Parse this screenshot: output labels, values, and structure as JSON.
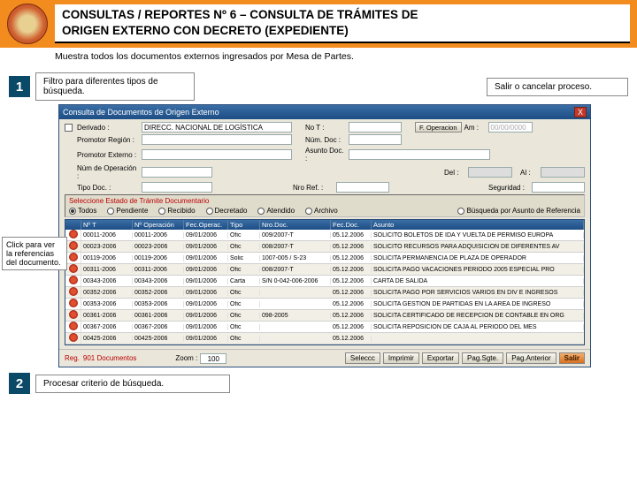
{
  "header": {
    "title_line1": "CONSULTAS / REPORTES Nº 6 – CONSULTA DE TRÁMITES DE",
    "title_line2": "ORIGEN EXTERNO CON DECRETO (EXPEDIENTE)",
    "subtitle": "Muestra todos los documentos externos ingresados por Mesa de Partes."
  },
  "annotations": {
    "n1": "1",
    "a1": "Filtro para diferentes tipos de búsqueda.",
    "a1r": "Salir o cancelar proceso.",
    "side": "Click para ver la referencias del documento.",
    "n2": "2",
    "a2": "Procesar criterio de búsqueda."
  },
  "win": {
    "title": "Consulta de Documentos de Origen Externo",
    "close": "X",
    "form": {
      "derivado_lbl": "Derivado :",
      "derivado_val": "DIRECC. NACIONAL DE LOGÍSTICA",
      "nrot_lbl": "No T :",
      "foper_btn": "F. Operacion",
      "flbl": "Am :",
      "fval": "00/00/0000",
      "promreg_lbl": "Promotor Región :",
      "nrodoc_lbl": "Núm. Doc :",
      "promext_lbl": "Promotor Externo :",
      "asunto_lbl": "Asunto Doc. :",
      "nop_lbl": "Núm de Operación :",
      "del_lbl": "Del :",
      "al_lbl": "Al :",
      "tpod_lbl": "Tipo Doc. :",
      "nref_lbl": "Nro Ref. :",
      "seg_lbl": "Seguridad :"
    },
    "radios": {
      "title": "Seleccione Estado de Trámite Documentario",
      "r1": "Todos",
      "r2": "Pendiente",
      "r3": "Recibido",
      "r4": "Decretado",
      "r5": "Atendido",
      "r6": "Archivo",
      "rref": "Búsqueda por Asunto de Referencia"
    },
    "grid": {
      "h0": "",
      "h1": "Nº T",
      "h2": "Nº Operación",
      "h3": "Fec.Operac.",
      "h4": "Tipo",
      "h5": "Nro.Doc.",
      "h6": "Fec.Doc.",
      "h7": "Asunto",
      "rows": [
        {
          "c1": "00011-2006",
          "c2": "00011-2006",
          "c3": "09/01/2006",
          "c4": "Ofic",
          "c5": "009/2007-T",
          "c6": "05.12.2006",
          "c7": "SOLICITO BOLETOS DE IDA Y VUELTA DE PERMISO EUROPA"
        },
        {
          "c1": "00023-2006",
          "c2": "00023-2006",
          "c3": "09/01/2006",
          "c4": "Ofic",
          "c5": "008/2007-T",
          "c6": "05.12.2006",
          "c7": "SOLICITO RECURSOS PARA ADQUISICION DE DIFERENTES AV"
        },
        {
          "c1": "00119-2006",
          "c2": "00119-2006",
          "c3": "09/01/2006",
          "c4": "Solic",
          "c5": "1007-005 / S-23",
          "c6": "05.12.2006",
          "c7": "SOLICITA PERMANENCIA DE PLAZA DE OPERADOR"
        },
        {
          "c1": "00311-2006",
          "c2": "00311-2006",
          "c3": "09/01/2006",
          "c4": "Ofic",
          "c5": "008/2007-T",
          "c6": "05.12.2006",
          "c7": "SOLICITA PAGO VACACIONES PERIODO 2005 ESPECIAL PRO"
        },
        {
          "c1": "00343-2006",
          "c2": "00343-2006",
          "c3": "09/01/2006",
          "c4": "Carta",
          "c5": "S/N 0-042-006-2006",
          "c6": "05.12.2006",
          "c7": "CARTA DE SALIDA"
        },
        {
          "c1": "00352-2006",
          "c2": "00352-2006",
          "c3": "09/01/2006",
          "c4": "Ofic",
          "c5": "",
          "c6": "05.12.2006",
          "c7": "SOLICITA PAGO POR SERVICIOS VARIOS EN DIV E INGRESOS"
        },
        {
          "c1": "00353-2006",
          "c2": "00353-2006",
          "c3": "09/01/2006",
          "c4": "Ofic",
          "c5": "",
          "c6": "05.12.2006",
          "c7": "SOLICITA GESTION DE PARTIDAS EN LA AREA DE INGRESO"
        },
        {
          "c1": "00361-2006",
          "c2": "00361-2006",
          "c3": "09/01/2006",
          "c4": "Ofic",
          "c5": "098-2005",
          "c6": "05.12.2006",
          "c7": "SOLICITA CERTIFICADO DE RECEPCION DE CONTABLE EN ORG"
        },
        {
          "c1": "00367-2006",
          "c2": "00367-2006",
          "c3": "09/01/2006",
          "c4": "Ofic",
          "c5": "",
          "c6": "05.12.2006",
          "c7": "SOLICITA REPOSICION DE CAJA AL PERIODO DEL MES"
        },
        {
          "c1": "00425-2006",
          "c2": "00425-2006",
          "c3": "09/01/2006",
          "c4": "Ofic",
          "c5": "",
          "c6": "05.12.2006",
          "c7": ""
        }
      ]
    },
    "status": {
      "left_lbl": "Reg.",
      "left_val": "901 Documentos",
      "zoom_lbl": "Zoom :",
      "zoom_val": "100",
      "b1": "Seleccc",
      "b2": "Imprimir",
      "b3": "Exportar",
      "b4": "Pag.Sgte.",
      "b5": "Pag.Anterior",
      "b6": "Salir"
    }
  }
}
